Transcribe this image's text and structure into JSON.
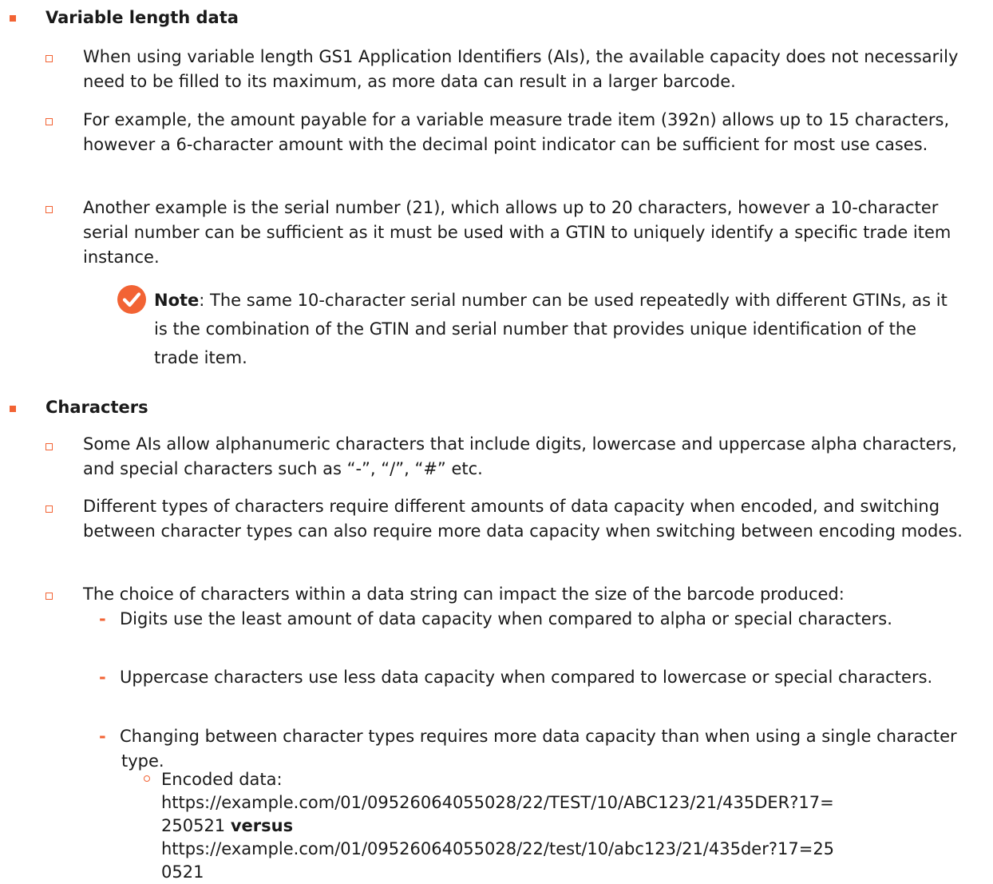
{
  "sections": [
    {
      "heading": "Variable length data",
      "items": [
        "When using variable length GS1 Application Identifiers (AIs), the available capacity does not necessarily need to be filled to its maximum, as more data can result in a larger barcode.",
        "For example, the amount payable for a variable measure trade item (392n) allows up to 15 characters, however a 6-character amount with the decimal point indicator can be sufficient for most use cases.",
        "Another example is the serial number (21), which allows up to 20 characters, however a 10-character serial number can be sufficient as it must be used with a GTIN to uniquely identify a specific trade item instance."
      ],
      "note": {
        "label": "Note",
        "text": ": The same 10-character serial number can be used repeatedly with different GTINs, as it is the combination of the GTIN and serial number that provides unique identification of the trade item."
      }
    },
    {
      "heading": "Characters",
      "items": [
        "Some AIs allow alphanumeric characters that include digits, lowercase and uppercase alpha characters, and special characters such as “-”, “/”, “#” etc.",
        "Different types of characters require different amounts of data capacity when encoded, and switching between character types can also require more data capacity when switching between encoding modes.",
        "The choice of characters within a data string can impact the size of the barcode produced:"
      ],
      "sub_items": [
        "Digits use the least amount of data capacity when compared to alpha or special characters.",
        "Uppercase characters use less data capacity when compared to lowercase or special characters.",
        "Changing between character types requires more data capacity than when using a single character type."
      ],
      "encoded": {
        "label": "Encoded data:",
        "url_a_line1": "https://example.com/01/09526064055028/22/TEST/10/ABC123/21/435DER?17=",
        "url_a_line2": "250521",
        "versus": "versus",
        "url_b_line1": "https://example.com/01/09526064055028/22/test/10/abc123/21/435der?17=25",
        "url_b_line2": "0521"
      }
    }
  ],
  "colors": {
    "accent": "#f26334",
    "text": "#1a1a1a",
    "check_icon": "#f26334"
  },
  "icons": {
    "note": "check-circle-icon"
  }
}
